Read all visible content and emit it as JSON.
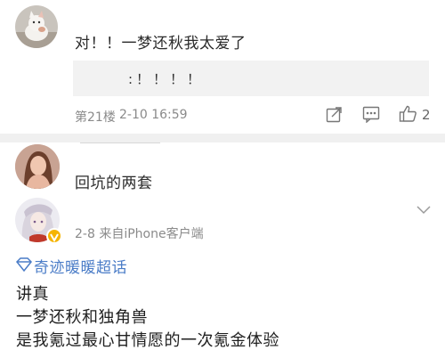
{
  "comment1": {
    "text": "对！！一梦还秋我太爱了",
    "quote": ":！！！！",
    "floor": "第21楼",
    "date_time": "2-10 16:59",
    "like_count": "2"
  },
  "comment2": {
    "text": "回坑的两套"
  },
  "post": {
    "date_source": "2-8 来自iPhone客户端",
    "topic": "奇迹暖暖超话",
    "lines": [
      "讲真",
      "一梦还秋和独角兽",
      "是我氪过最心甘情愿的一次氪金体验"
    ]
  },
  "icons": {
    "share": "share-icon",
    "comment": "comment-icon",
    "like": "thumbs-up-icon",
    "chevron": "chevron-down-icon",
    "topic": "diamond-topic-icon",
    "badge": "vip-badge-icon"
  },
  "colors": {
    "topic_link": "#4a7cc7",
    "meta_gray": "#8a8a8a",
    "badge": "#f5b400"
  }
}
